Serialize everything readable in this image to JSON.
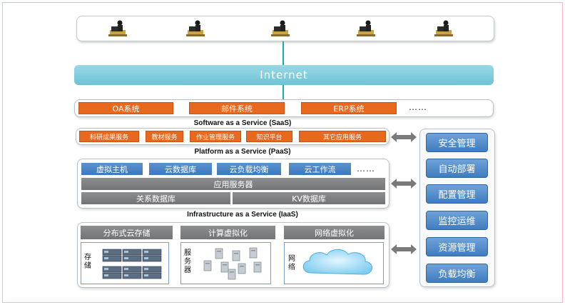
{
  "internet": {
    "label": "Internet"
  },
  "saas": {
    "apps": [
      "OA系统",
      "邮件系统",
      "ERP系统"
    ],
    "more": "……",
    "title": "Software as a Service (SaaS)",
    "services": [
      "科研成果服务",
      "教材服务",
      "作业管理服务",
      "知识平台",
      "其它应用服务"
    ]
  },
  "paas": {
    "title": "Platform as a Service (PaaS)",
    "items": [
      "虚拟主机",
      "云数据库",
      "云负载均衡",
      "云工作流"
    ],
    "more": "……",
    "app_server": "应用服务器",
    "rel_db": "关系数据库",
    "kv_db": "KV数据库"
  },
  "iaas": {
    "title": "Infrastructure as a Service (IaaS)",
    "headers": [
      "分布式云存储",
      "计算虚拟化",
      "网络虚拟化"
    ],
    "storage_label": "存储",
    "server_label": "服务器",
    "network_label": "网络"
  },
  "management": [
    "安全管理",
    "自动部署",
    "配置管理",
    "监控运维",
    "资源管理",
    "负载均衡"
  ],
  "colors": {
    "orange": "#e8681e",
    "blue": "#3d78bd",
    "gray": "#7d7e80",
    "internet": "#7cc9da",
    "line": "#1aa7b8"
  }
}
